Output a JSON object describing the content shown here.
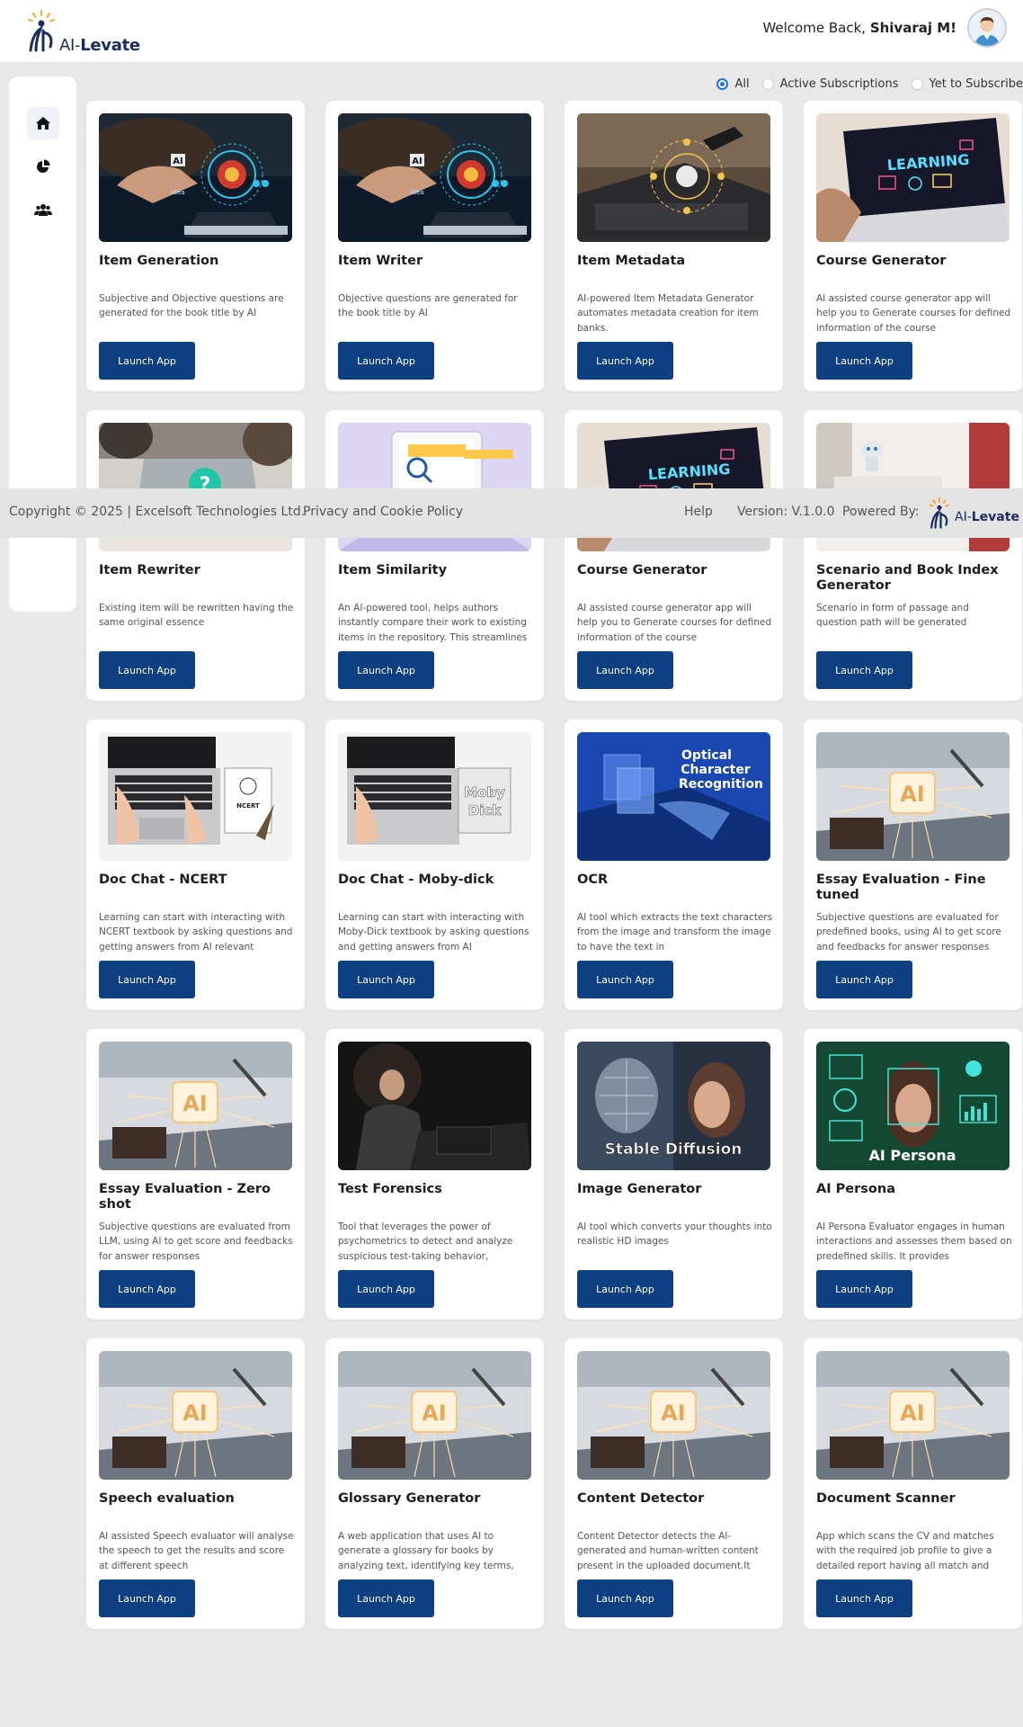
{
  "header": {
    "logo_text_a": "AI-",
    "logo_text_b": "Levate",
    "welcome_prefix": "Welcome Back,",
    "user_name": "Shivaraj M!"
  },
  "filters": {
    "options": [
      "All",
      "Active Subscriptions",
      "Yet to Subscribe"
    ],
    "selected": "All"
  },
  "button_label": "Launch App",
  "cards": [
    {
      "title": "Item Generation",
      "desc": "Subjective and Objective questions are generated for the book title by AI",
      "image": "ai-hand-tablet"
    },
    {
      "title": "Item Writer",
      "desc": "Objective questions are generated for the book title by AI",
      "image": "ai-hand-tablet"
    },
    {
      "title": "Item Metadata",
      "desc": "AI-powered Item Metadata Generator automates metadata creation for item banks.",
      "image": "laptop-network"
    },
    {
      "title": "Course Generator",
      "desc": "AI assisted course generator app will help you to Generate courses for defined information of the course",
      "image": "learning-laptop"
    },
    {
      "title": "Item Rewriter",
      "desc": "Existing item will be rewritten having the same original essence",
      "image": "question-laptop"
    },
    {
      "title": "Item Similarity",
      "desc": "An AI-powered tool, helps authors instantly compare their work to existing items in the repository. This streamlines",
      "image": "search-document"
    },
    {
      "title": "Course Generator",
      "desc": "AI assisted course generator app will help you to Generate courses for defined information of the course",
      "image": "learning-laptop"
    },
    {
      "title": "Scenario and Book Index Generator",
      "desc": "Scenario in form of passage and question path will be generated",
      "image": "robot"
    },
    {
      "title": "Doc Chat - NCERT",
      "desc": "Learning can start with interacting with NCERT textbook by asking questions and getting answers from AI relevant",
      "image": "laptop-ncert"
    },
    {
      "title": "Doc Chat - Moby-dick",
      "desc": "Learning can start with interacting with Moby-Dick textbook by asking questions and getting answers from AI",
      "image": "laptop-mobydick"
    },
    {
      "title": "OCR",
      "desc": "AI tool which extracts the text characters from the image and transform the image to have the text in",
      "image": "ocr"
    },
    {
      "title": "Essay Evaluation - Fine tuned",
      "desc": "Subjective questions are evaluated for predefined books, using AI to get score and feedbacks for answer responses",
      "image": "ai-chip"
    },
    {
      "title": "Essay Evaluation - Zero shot",
      "desc": "Subjective questions are evaluated from LLM, using AI to get score and feedbacks for answer responses",
      "image": "ai-chip"
    },
    {
      "title": "Test Forensics",
      "desc": "Tool that leverages the power of psychometrics to detect and analyze suspicious test-taking behavior,",
      "image": "dark-person"
    },
    {
      "title": "Image Generator",
      "desc": "AI tool which converts your thoughts into realistic HD images",
      "image": "stable-diffusion"
    },
    {
      "title": "AI Persona",
      "desc": "AI Persona Evaluator engages in human interactions and assesses them based on predefined skills. It provides",
      "image": "ai-persona"
    },
    {
      "title": "Speech evaluation",
      "desc": "AI assisted Speech evaluator will analyse the speech to get the results and score at different speech",
      "image": "ai-chip"
    },
    {
      "title": "Glossary Generator",
      "desc": "A web application that uses AI to generate a glossary for books by analyzing text, identifying key terms,",
      "image": "ai-chip"
    },
    {
      "title": "Content Detector",
      "desc": "Content Detector detects the AI-generated and human-written content present in the uploaded document.It",
      "image": "ai-chip"
    },
    {
      "title": "Document Scanner",
      "desc": "App which scans the CV and matches with the required job profile to give a detailed report having all match and",
      "image": "ai-chip"
    }
  ],
  "image_captions": {
    "ocr_1": "Optical",
    "ocr_2": "Character",
    "ocr_3": "Recognition",
    "stable": "Stable Diffusion",
    "persona": "AI Persona",
    "learning": "LEARNING",
    "ncert": "NCERT",
    "moby_1": "Moby",
    "moby_2": "Dick",
    "ai": "AI",
    "ai_idea": "Idea"
  },
  "footer": {
    "copyright": "Copyright © 2025 | Excelsoft Technologies Ltd.",
    "privacy": "Privacy and Cookie Policy",
    "help": "Help",
    "version": "Version: V.1.0.0",
    "powered_by": "Powered By:",
    "logo_text_a": "AI-",
    "logo_text_b": "Levate"
  },
  "colors": {
    "primary_button": "#0e3f82",
    "radio_selected": "#1a73e8",
    "logo_blue": "#1a2b5f",
    "logo_orange": "#f5a623"
  },
  "icons": {
    "sidebar": [
      "home-icon",
      "pie-chart-icon",
      "users-icon"
    ]
  }
}
